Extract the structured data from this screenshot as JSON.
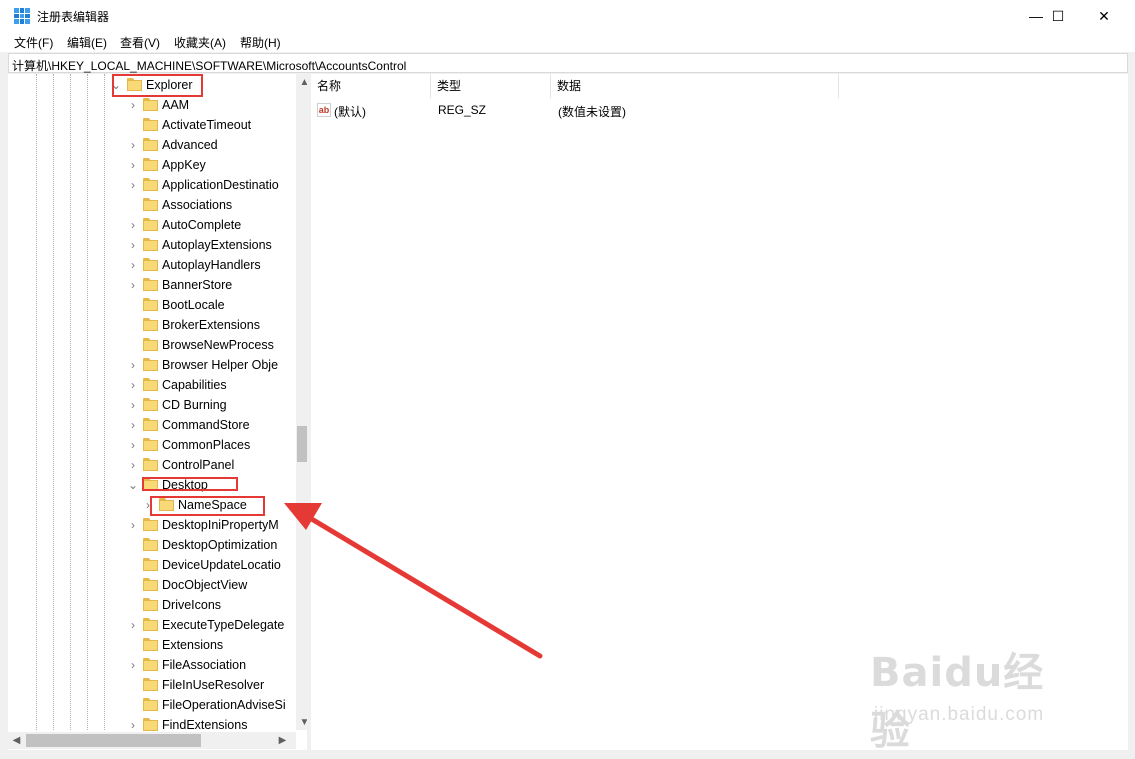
{
  "window": {
    "title": "注册表编辑器",
    "minimize_glyph": "—",
    "maximize_glyph": "☐",
    "close_glyph": "✕"
  },
  "menu": [
    "文件(F)",
    "编辑(E)",
    "查看(V)",
    "收藏夹(A)",
    "帮助(H)"
  ],
  "address": "计算机\\HKEY_LOCAL_MACHINE\\SOFTWARE\\Microsoft\\AccountsControl",
  "tree": {
    "parent": {
      "label": "Explorer",
      "expanded": true
    },
    "items": [
      {
        "label": "AAM",
        "expandable": true
      },
      {
        "label": "ActivateTimeout",
        "expandable": false
      },
      {
        "label": "Advanced",
        "expandable": true
      },
      {
        "label": "AppKey",
        "expandable": true
      },
      {
        "label": "ApplicationDestinatio",
        "expandable": true
      },
      {
        "label": "Associations",
        "expandable": false
      },
      {
        "label": "AutoComplete",
        "expandable": true
      },
      {
        "label": "AutoplayExtensions",
        "expandable": true
      },
      {
        "label": "AutoplayHandlers",
        "expandable": true
      },
      {
        "label": "BannerStore",
        "expandable": true
      },
      {
        "label": "BootLocale",
        "expandable": false
      },
      {
        "label": "BrokerExtensions",
        "expandable": false
      },
      {
        "label": "BrowseNewProcess",
        "expandable": false
      },
      {
        "label": "Browser Helper Obje",
        "expandable": true
      },
      {
        "label": "Capabilities",
        "expandable": true
      },
      {
        "label": "CD Burning",
        "expandable": true
      },
      {
        "label": "CommandStore",
        "expandable": true
      },
      {
        "label": "CommonPlaces",
        "expandable": true
      },
      {
        "label": "ControlPanel",
        "expandable": true
      },
      {
        "label": "Desktop",
        "expandable": true,
        "expanded": true
      },
      {
        "label": "NameSpace",
        "expandable": true,
        "child": true
      },
      {
        "label": "DesktopIniPropertyM",
        "expandable": true
      },
      {
        "label": "DesktopOptimization",
        "expandable": false
      },
      {
        "label": "DeviceUpdateLocatio",
        "expandable": false
      },
      {
        "label": "DocObjectView",
        "expandable": false
      },
      {
        "label": "DriveIcons",
        "expandable": false
      },
      {
        "label": "ExecuteTypeDelegate",
        "expandable": true
      },
      {
        "label": "Extensions",
        "expandable": false
      },
      {
        "label": "FileAssociation",
        "expandable": true
      },
      {
        "label": "FileInUseResolver",
        "expandable": false
      },
      {
        "label": "FileOperationAdviseSi",
        "expandable": false
      },
      {
        "label": "FindExtensions",
        "expandable": true
      }
    ]
  },
  "values_pane": {
    "columns": [
      "名称",
      "类型",
      "数据"
    ],
    "rows": [
      {
        "icon": "string-value-icon",
        "icon_text": "ab",
        "name": "(默认)",
        "type": "REG_SZ",
        "data": "(数值未设置)"
      }
    ]
  },
  "watermark": {
    "logo_text": "Baidu经验",
    "url": "jingyan.baidu.com"
  },
  "colors": {
    "annotation_red": "#e53935",
    "folder_yellow": "#f9d877"
  }
}
